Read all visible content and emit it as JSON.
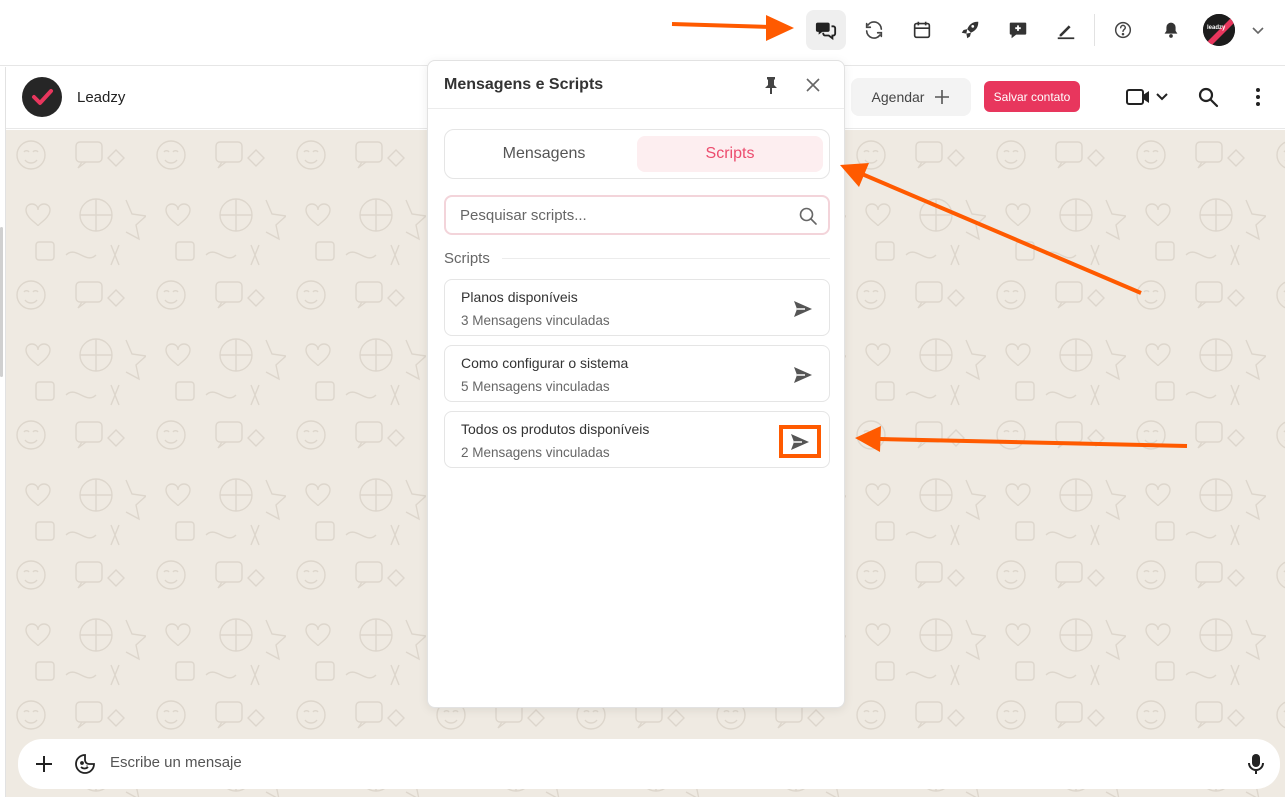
{
  "topbar": {
    "icons": [
      "messages-scripts-icon",
      "sync-icon",
      "calendar-icon",
      "rocket-icon",
      "quick-reply-icon",
      "pen-icon",
      "help-icon",
      "bell-icon"
    ],
    "avatar_label": "leadzy"
  },
  "chat_header": {
    "contact_name": "Leadzy",
    "schedule_label": "Agendar",
    "save_contact_label": "Salvar contato"
  },
  "panel": {
    "title": "Mensagens e Scripts",
    "tabs": [
      {
        "label": "Mensagens",
        "active": false
      },
      {
        "label": "Scripts",
        "active": true
      }
    ],
    "search_placeholder": "Pesquisar scripts...",
    "section_label": "Scripts",
    "scripts": [
      {
        "title": "Planos disponíveis",
        "subtitle": "3 Mensagens vinculadas"
      },
      {
        "title": "Como configurar o sistema",
        "subtitle": "5 Mensagens vinculadas"
      },
      {
        "title": "Todos os produtos disponíveis",
        "subtitle": "2 Mensagens vinculadas"
      }
    ]
  },
  "composer": {
    "placeholder": "Escribe un mensaje"
  },
  "colors": {
    "accent": "#e8365d",
    "tab_active_bg": "#fdeef0",
    "tab_active_text": "#ec4c6e",
    "annotation": "#ff5a00",
    "chat_bg": "#efeae2"
  }
}
